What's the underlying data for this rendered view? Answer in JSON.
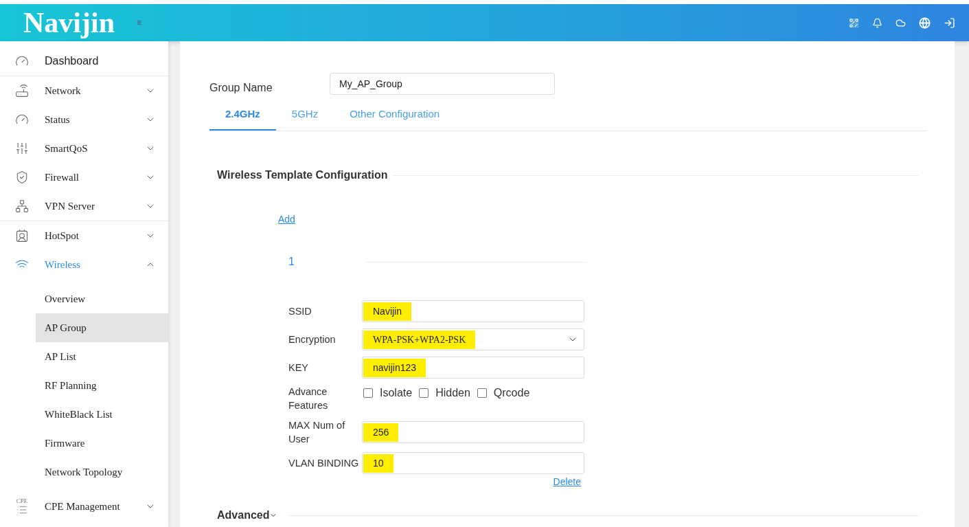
{
  "header": {
    "logo": "Navijin",
    "menu_glyph": "≡"
  },
  "sidebar": {
    "sections": [
      [
        {
          "label": "Dashboard",
          "kind": "link",
          "selected": false
        }
      ],
      [
        {
          "label": "Network",
          "kind": "group",
          "expanded": false,
          "selected": false
        },
        {
          "label": "Status",
          "kind": "group",
          "expanded": false,
          "selected": false
        },
        {
          "label": "SmartQoS",
          "kind": "group",
          "expanded": false,
          "selected": false
        },
        {
          "label": "Firewall",
          "kind": "group",
          "expanded": false,
          "selected": false
        },
        {
          "label": "VPN Server",
          "kind": "group",
          "expanded": false,
          "selected": false
        }
      ],
      [
        {
          "label": "HotSpot",
          "kind": "group",
          "expanded": false,
          "selected": false
        },
        {
          "label": "Wireless",
          "kind": "group",
          "expanded": true,
          "selected": true,
          "children": [
            {
              "label": "Overview",
              "selected": false
            },
            {
              "label": "AP Group",
              "selected": true
            },
            {
              "label": "AP List",
              "selected": false
            },
            {
              "label": "RF Planning",
              "selected": false
            },
            {
              "label": "WhiteBlack List",
              "selected": false
            },
            {
              "label": "Firmware",
              "selected": false
            },
            {
              "label": "Network Topology",
              "selected": false
            }
          ]
        },
        {
          "label": "CPE Management",
          "kind": "group",
          "expanded": false,
          "selected": false,
          "icon_text": "CPE"
        }
      ]
    ]
  },
  "group_name": {
    "label": "Group Name",
    "value": "My_AP_Group"
  },
  "tabs": [
    {
      "label": "2.4GHz",
      "selected": true
    },
    {
      "label": "5GHz",
      "selected": false
    },
    {
      "label": "Other Configuration",
      "selected": false
    }
  ],
  "section": {
    "title": "Wireless Template Configuration",
    "add_link": "Add",
    "template_index": "1",
    "fields": [
      {
        "kind": "text",
        "label": "SSID",
        "value": "Navijin",
        "highlighted": true
      },
      {
        "kind": "select",
        "label": "Encryption",
        "value": "WPA-PSK+WPA2-PSK",
        "highlighted": true
      },
      {
        "kind": "text",
        "label": "KEY",
        "value": "navijin123",
        "highlighted": true
      },
      {
        "kind": "checkboxes",
        "label": "Advance Features",
        "options": [
          {
            "label": "Isolate",
            "checked": false
          },
          {
            "label": "Hidden",
            "checked": false
          },
          {
            "label": "Qrcode",
            "checked": false
          }
        ]
      },
      {
        "kind": "text",
        "label": "MAX Num of User",
        "value": "256",
        "highlighted": true
      },
      {
        "kind": "text",
        "label": "VLAN BINDING",
        "value": "10",
        "highlighted": true
      }
    ],
    "delete_link": "Delete"
  },
  "advanced": {
    "label": "Advanced",
    "expanded": false
  }
}
